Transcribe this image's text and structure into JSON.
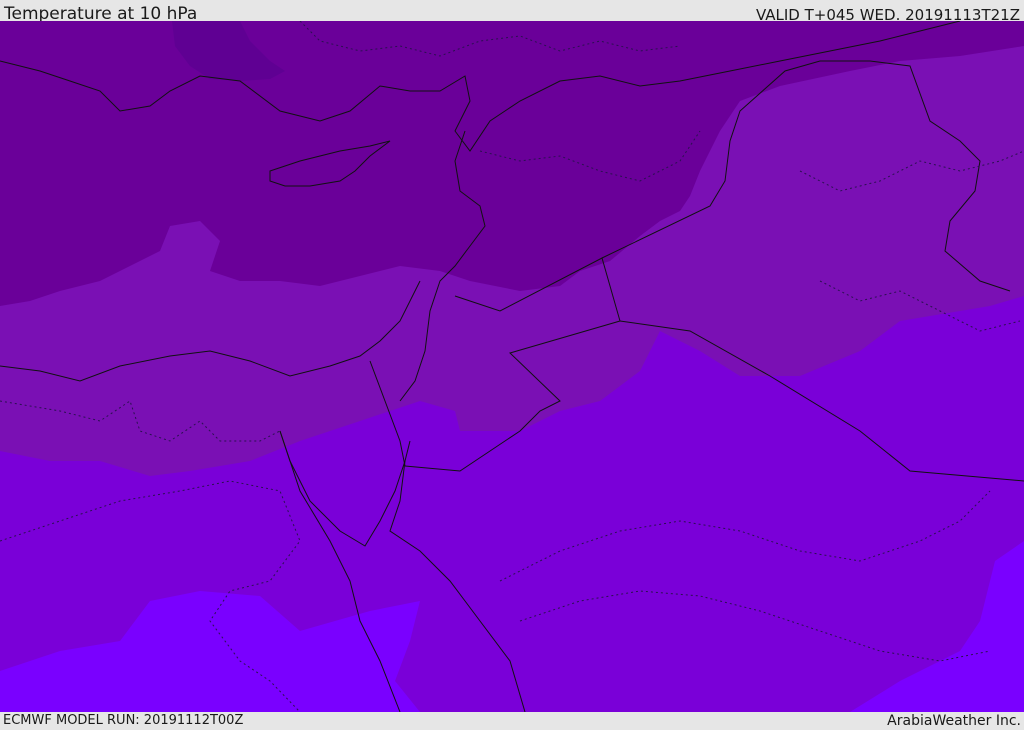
{
  "header": {
    "field_title": "Temperature at 10 hPa",
    "valid_time": "VALID T+045 WED. 20191113T21Z"
  },
  "footer": {
    "model_run": "ECMWF MODEL RUN: 20191112T00Z",
    "provider": "ArabiaWeather Inc."
  },
  "map": {
    "field": "temperature",
    "pressure_level_hpa": 10,
    "colors": {
      "band_1": "#5f0093",
      "band_2": "#6a0099",
      "band_3": "#7a10b4",
      "band_4": "#7a00d8",
      "band_5": "#7a00ff"
    }
  }
}
